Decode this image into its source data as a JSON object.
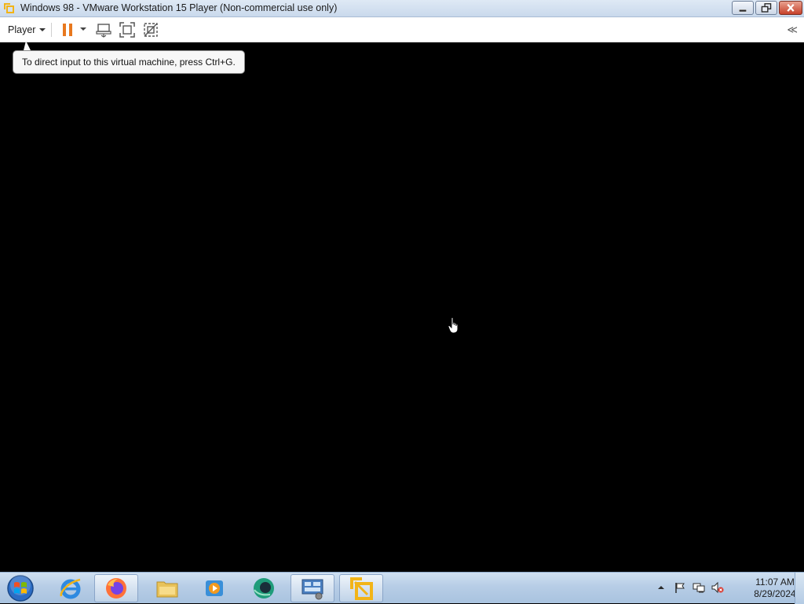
{
  "window": {
    "title": "Windows 98 - VMware Workstation 15 Player (Non-commercial use only)",
    "icon": "vmware-logo-icon",
    "buttons": [
      "minimize",
      "restore",
      "close"
    ]
  },
  "toolbar": {
    "player_label": "Player",
    "icons": [
      "pause-icon",
      "send-ctrl-alt-del-icon",
      "fullscreen-icon",
      "unity-icon"
    ],
    "collapse_glyph": "≪"
  },
  "tooltip": {
    "text": "To direct input to this virtual machine, press Ctrl+G."
  },
  "taskbar": {
    "apps": [
      {
        "name": "internet-explorer-icon",
        "active": false
      },
      {
        "name": "firefox-icon",
        "active": true
      },
      {
        "name": "file-explorer-icon",
        "active": false
      },
      {
        "name": "media-player-icon",
        "active": false
      },
      {
        "name": "green-app-icon",
        "active": false
      },
      {
        "name": "control-panel-icon",
        "active": true
      },
      {
        "name": "vmware-player-icon",
        "active": true
      }
    ],
    "tray_icons": [
      "show-hidden-icons-arrow",
      "action-center-flag-icon",
      "network-icon",
      "volume-muted-icon"
    ],
    "clock": {
      "time": "11:07 AM",
      "date": "8/29/2024"
    }
  },
  "colors": {
    "vm_background": "#000000",
    "titlebar": "#d3e1f1",
    "taskbar": "#b7cde6",
    "pause_accent": "#e8781e",
    "vmware_accent": "#f2b417"
  }
}
